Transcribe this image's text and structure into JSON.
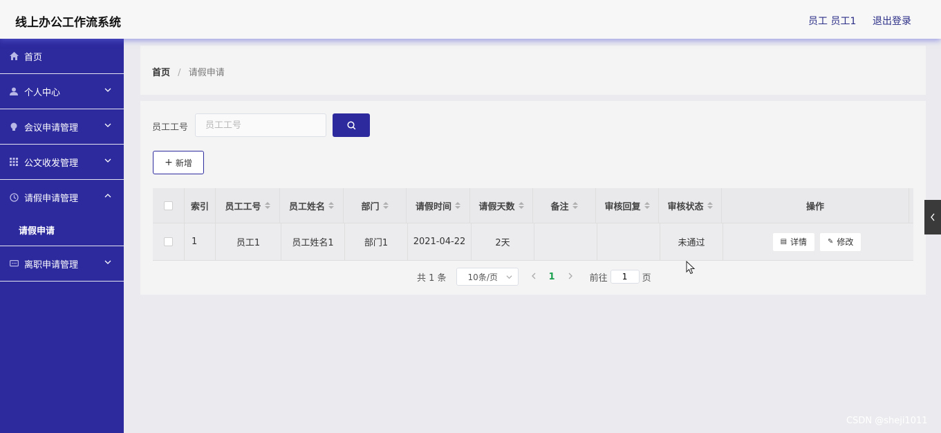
{
  "header": {
    "title": "线上办公工作流系统",
    "user": "员工 员工1",
    "logout": "退出登录"
  },
  "sidebar": {
    "items": [
      {
        "label": "首页",
        "icon": "home-icon"
      },
      {
        "label": "个人中心",
        "icon": "user-icon"
      },
      {
        "label": "会议申请管理",
        "icon": "bulb-icon"
      },
      {
        "label": "公文收发管理",
        "icon": "grid-icon"
      },
      {
        "label": "请假申请管理",
        "icon": "clock-icon",
        "expanded": true
      },
      {
        "label": "请假申请",
        "sub": true
      },
      {
        "label": "离职申请管理",
        "icon": "chat-icon"
      }
    ]
  },
  "breadcrumb": {
    "home": "首页",
    "separator": "/",
    "current": "请假申请"
  },
  "search": {
    "label": "员工工号",
    "placeholder": "员工工号"
  },
  "toolbar": {
    "add_label": "新增"
  },
  "table": {
    "columns": [
      "索引",
      "员工工号",
      "员工姓名",
      "部门",
      "请假时间",
      "请假天数",
      "备注",
      "审核回复",
      "审核状态",
      "操作"
    ],
    "rows": [
      {
        "index": "1",
        "emp_no": "员工1",
        "emp_name": "员工姓名1",
        "dept": "部门1",
        "date": "2021-04-22",
        "days": "2天",
        "remark": "",
        "reply": "",
        "status": "未通过"
      }
    ],
    "actions": {
      "detail": "详情",
      "edit": "修改"
    }
  },
  "pagination": {
    "total": "共 1 条",
    "page_size": "10条/页",
    "current_page": "1",
    "goto_prefix": "前往",
    "goto_value": "1",
    "goto_suffix": "页"
  },
  "watermark": "CSDN @sheji1011",
  "colors": {
    "accent": "#2d2a9e",
    "page_active": "#1aa04f"
  }
}
